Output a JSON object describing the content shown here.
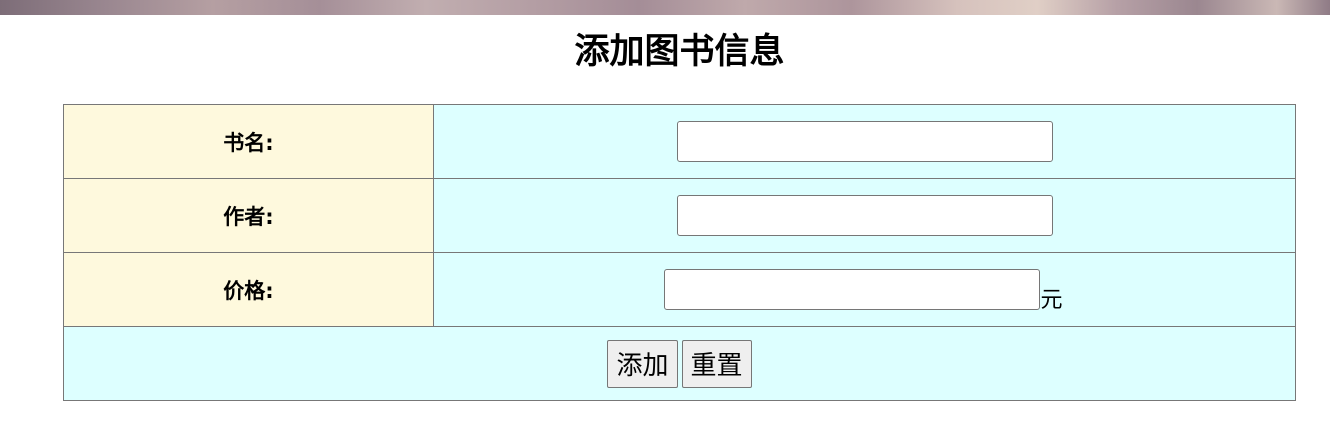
{
  "page": {
    "title": "添加图书信息"
  },
  "form": {
    "fields": [
      {
        "label": "书名:",
        "value": ""
      },
      {
        "label": "作者:",
        "value": ""
      },
      {
        "label": "价格:",
        "value": "",
        "unit": "元"
      }
    ],
    "buttons": {
      "submit_label": "添加",
      "reset_label": "重置"
    }
  },
  "colors": {
    "label_bg": "#fef9dd",
    "input_bg": "#ddffff",
    "border": "#777777"
  }
}
